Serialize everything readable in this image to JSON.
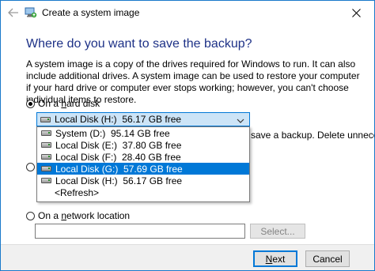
{
  "window": {
    "title": "Create a system image",
    "heading": "Where do you want to save the backup?",
    "description": "A system image is a copy of the drives required for Windows to run. It can also include additional drives. A system image can be used to restore your computer if your hard drive or computer ever stops working; however, you can't choose individual items to restore."
  },
  "hard_disk": {
    "label_prefix": "On a ",
    "label_accel": "h",
    "label_suffix": "ard disk",
    "checked": true,
    "selected_drive": "Local Disk (H:)  56.17 GB free",
    "options": [
      "System (D:)  95.14 GB free",
      "Local Disk (E:)  37.80 GB free",
      "Local Disk (F:)  28.40 GB free",
      "Local Disk (G:)  57.69 GB free",
      "Local Disk (H:)  56.17 GB free"
    ],
    "highlighted_index": 3,
    "refresh_label": "<Refresh>",
    "partial_message": "save a backup. Delete unnecessary"
  },
  "network": {
    "label_prefix": "On a ",
    "label_accel": "n",
    "label_suffix": "etwork location",
    "checked": false,
    "path_value": "",
    "select_button": "Select..."
  },
  "footer": {
    "next_prefix": "",
    "next_accel": "N",
    "next_suffix": "ext",
    "cancel_label": "Cancel"
  },
  "icons": {
    "back": "back-arrow-icon",
    "app": "backup-icon",
    "close": "close-icon",
    "combo_arrow": "chevron-down-icon",
    "drive": "drive-icon"
  },
  "colors": {
    "accent": "#0078d7",
    "heading": "#1e3287",
    "selection": "#0078d7"
  }
}
